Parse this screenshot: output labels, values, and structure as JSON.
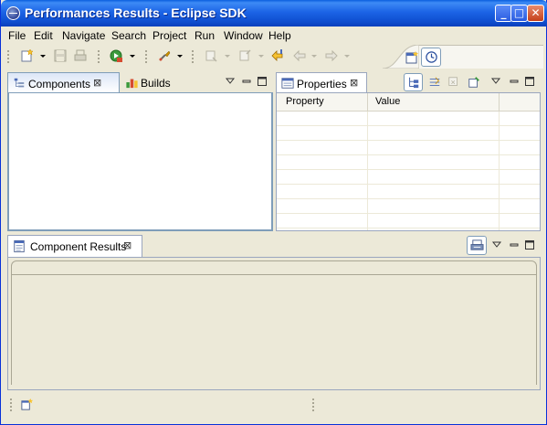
{
  "window": {
    "title": "Performances Results - Eclipse SDK"
  },
  "title_buttons": {
    "minimize": "_",
    "maximize": "□",
    "close": "✕"
  },
  "menu": {
    "items": [
      "File",
      "Edit",
      "Navigate",
      "Search",
      "Project",
      "Run",
      "Window",
      "Help"
    ]
  },
  "toolbar": {
    "icons": [
      "new-icon",
      "save-icon",
      "print-icon",
      "run-icon",
      "external-tools-icon",
      "next-annotation-icon",
      "previous-annotation-icon",
      "last-edit-location-icon",
      "back-icon",
      "forward-icon"
    ]
  },
  "perspectives": {
    "icons": [
      "open-perspective-icon",
      "performance-perspective-icon"
    ]
  },
  "components_view": {
    "tab_label": "Components",
    "other_tab_label": "Builds"
  },
  "properties_view": {
    "tab_label": "Properties",
    "columns": [
      "Property",
      "Value"
    ]
  },
  "results_view": {
    "tab_label": "Component Results"
  },
  "colors": {
    "titlebar": "#0A5EDF",
    "window_bg": "#ECE9D8",
    "view_border": "#9aa6be",
    "active_view_border": "#7F9DB9"
  }
}
